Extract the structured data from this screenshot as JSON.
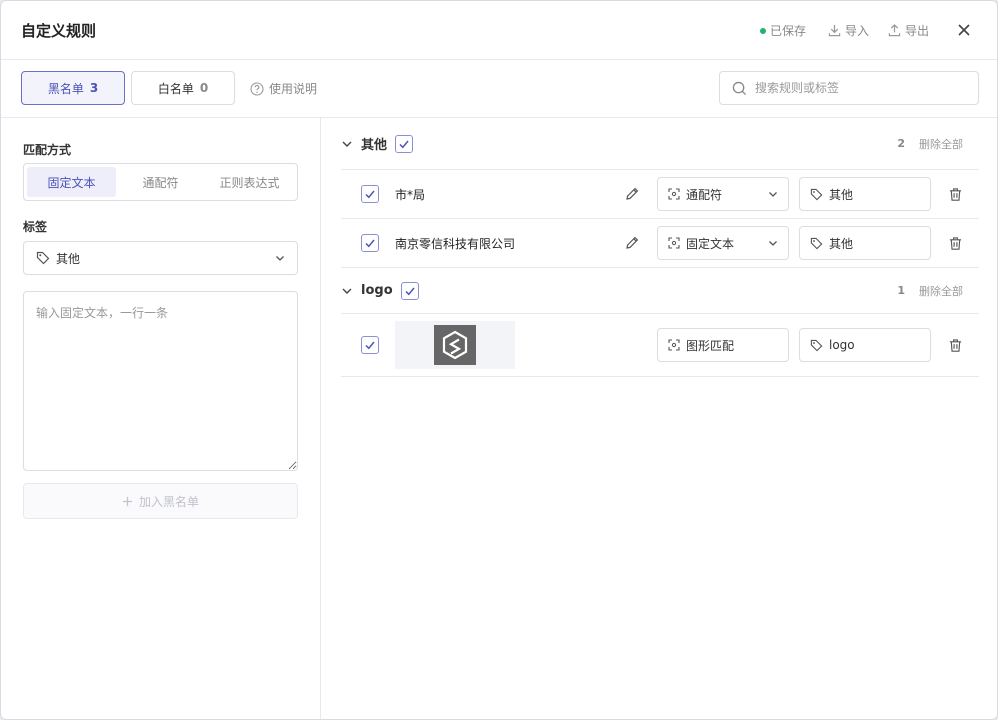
{
  "header": {
    "title": "自定义规则",
    "saved": "已保存",
    "import": "导入",
    "export": "导出"
  },
  "toolbar": {
    "blacklist_label": "黑名单",
    "blacklist_count": "3",
    "whitelist_label": "白名单",
    "whitelist_count": "0",
    "help": "使用说明",
    "search_placeholder": "搜索规则或标签"
  },
  "left": {
    "match_label": "匹配方式",
    "modes": [
      "固定文本",
      "通配符",
      "正则表达式"
    ],
    "tag_label": "标签",
    "tag_value": "其他",
    "textarea_placeholder": "输入固定文本，一行一条",
    "add_button": "加入黑名单"
  },
  "groups": [
    {
      "name": "其他",
      "count": "2",
      "delete_all": "删除全部",
      "rules": [
        {
          "text": "市*局",
          "mode": "通配符",
          "tag": "其他"
        },
        {
          "text": "南京零信科技有限公司",
          "mode": "固定文本",
          "tag": "其他"
        }
      ]
    },
    {
      "name": "logo",
      "count": "1",
      "delete_all": "删除全部",
      "rules": [
        {
          "mode": "图形匹配",
          "tag": "logo"
        }
      ]
    }
  ],
  "colors": {
    "accent": "#4b52b8",
    "saved_dot": "#23b26d"
  }
}
